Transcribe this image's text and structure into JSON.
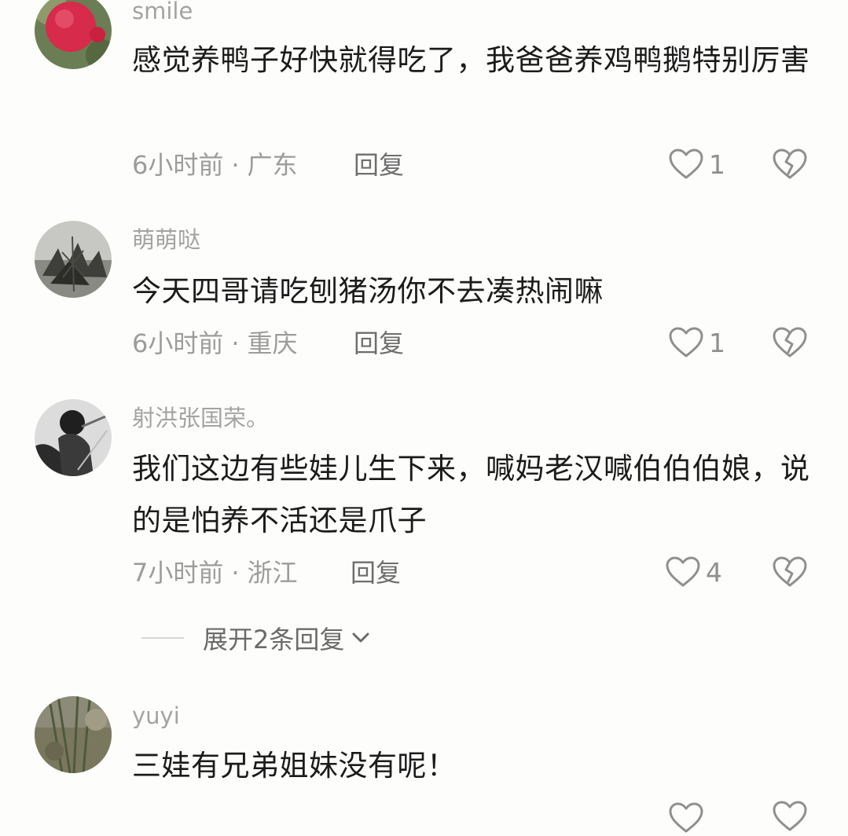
{
  "comments": [
    {
      "username": "smile",
      "text": "感觉养鸭子好快就得吃了，我爸爸养鸡鸭鹅特别厉害",
      "time": "6小时前",
      "location": "广东",
      "reply_label": "回复",
      "likes": "1"
    },
    {
      "username": "萌萌哒",
      "text": "今天四哥请吃刨猪汤你不去凑热闹嘛",
      "time": "6小时前",
      "location": "重庆",
      "reply_label": "回复",
      "likes": "1"
    },
    {
      "username": "射洪张国荣。",
      "text": "我们这边有些娃儿生下来，喊妈老汉喊伯伯伯娘，说的是怕养不活还是爪子",
      "time": "7小时前",
      "location": "浙江",
      "reply_label": "回复",
      "likes": "4",
      "expand_label": "展开2条回复"
    },
    {
      "username": "yuyi",
      "text": "三娃有兄弟姐妹没有呢！"
    }
  ],
  "icons": {
    "like": "heart-outline-icon",
    "dislike": "broken-heart-icon",
    "expand": "chevron-down-icon"
  },
  "colors": {
    "username": "#a3a3a3",
    "text": "#1b1b1b",
    "meta": "#9c9c9c",
    "icon": "#8f8f8f"
  }
}
